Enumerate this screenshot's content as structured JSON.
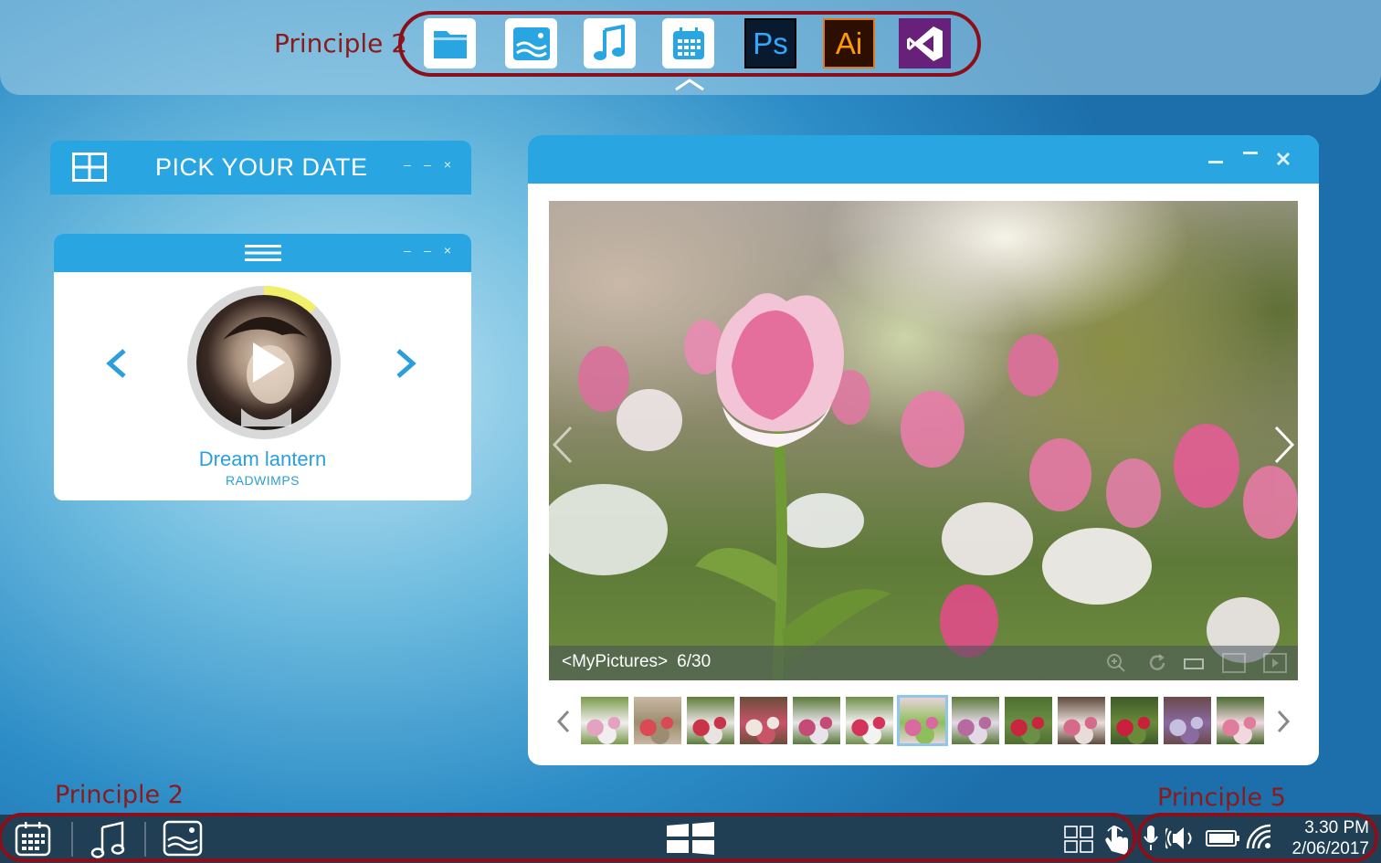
{
  "annotations": {
    "top": "Principle 2",
    "bottom_left": "Principle 2",
    "bottom_right": "Principle 5"
  },
  "dock": {
    "apps": [
      {
        "icon": "folder-icon",
        "label": ""
      },
      {
        "icon": "image-icon",
        "label": ""
      },
      {
        "icon": "music-note-icon",
        "label": ""
      },
      {
        "icon": "calendar-icon",
        "label": ""
      },
      {
        "icon": "photoshop-icon",
        "label": "Ps"
      },
      {
        "icon": "illustrator-icon",
        "label": "Ai"
      },
      {
        "icon": "visual-studio-icon",
        "label": ""
      }
    ]
  },
  "date_widget": {
    "title": "PICK YOUR DATE",
    "controls": [
      "–",
      "–",
      "×"
    ]
  },
  "music_widget": {
    "song": "Dream lantern",
    "artist": "RADWIMPS",
    "controls": [
      "–",
      "–",
      "×"
    ],
    "progress": 0.12
  },
  "photo_viewer": {
    "album": "<MyPictures>",
    "counter": "6/30",
    "selected_thumb": 6,
    "thumb_count": 13
  },
  "taskbar": {
    "time": "3.30 PM",
    "date": "2/06/2017"
  },
  "colors": {
    "accent": "#29a6e2",
    "annotation": "#8b1a1a",
    "taskbar": "#203f55"
  }
}
